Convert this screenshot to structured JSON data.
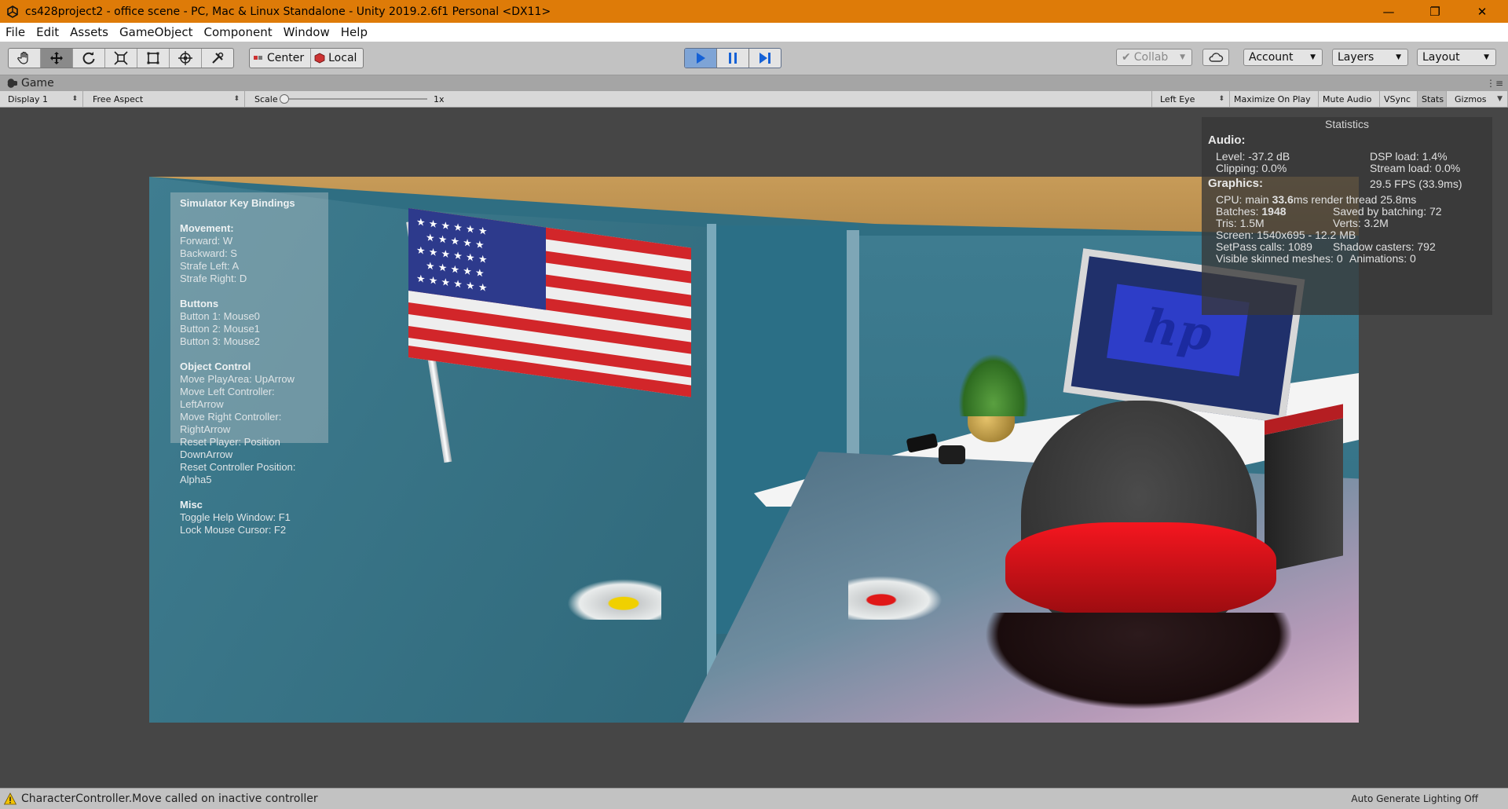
{
  "window": {
    "title": "cs428project2 - office scene - PC, Mac & Linux Standalone - Unity 2019.2.6f1 Personal <DX11>",
    "controls": [
      "—",
      "❐",
      "✕"
    ]
  },
  "menu": [
    "File",
    "Edit",
    "Assets",
    "GameObject",
    "Component",
    "Window",
    "Help"
  ],
  "toolbar": {
    "transform_tools": [
      "hand-tool",
      "move-tool",
      "rotate-tool",
      "scale-tool",
      "rect-tool",
      "transform-tool",
      "custom-tool"
    ],
    "active_tool": "move-tool",
    "pivot_label": "Center",
    "space_label": "Local",
    "play_state": "playing",
    "collab_label": "Collab",
    "account_label": "Account",
    "layers_label": "Layers",
    "layout_label": "Layout"
  },
  "tab": {
    "label": "Game"
  },
  "game_bar": {
    "display": "Display 1",
    "aspect": "Free Aspect",
    "scale_label": "Scale",
    "scale_value": "1x",
    "eye": "Left Eye",
    "maximize": "Maximize On Play",
    "mute": "Mute Audio",
    "vsync": "VSync",
    "stats": "Stats",
    "gizmos": "Gizmos"
  },
  "keybindings": {
    "title": "Simulator Key Bindings",
    "movement_header": "Movement:",
    "movement": [
      "Forward: W",
      "Backward: S",
      "Strafe Left: A",
      "Strafe Right: D"
    ],
    "buttons_header": "Buttons",
    "buttons": [
      "Button 1: Mouse0",
      "Button 2: Mouse1",
      "Button 3: Mouse2"
    ],
    "object_header": "Object Control",
    "object": [
      "Move PlayArea: UpArrow",
      "Move Left Controller: LeftArrow",
      "Move Right Controller: RightArrow",
      "Reset Player: Position DownArrow",
      "Reset Controller Position: Alpha5"
    ],
    "misc_header": "Misc",
    "misc": [
      "Toggle Help Window: F1",
      "Lock Mouse Cursor: F2"
    ]
  },
  "stats": {
    "title": "Statistics",
    "audio_header": "Audio:",
    "level": "Level: -37.2 dB",
    "clipping": "Clipping: 0.0%",
    "dsp": "DSP load: 1.4%",
    "stream": "Stream load: 0.0%",
    "graphics_header": "Graphics:",
    "fps": "29.5 FPS (33.9ms)",
    "cpu_prefix": "CPU: main ",
    "cpu_main": "33.6",
    "cpu_suffix": "ms  render thread 25.8ms",
    "batches_prefix": "Batches: ",
    "batches": "1948",
    "saved": "Saved by batching: 72",
    "tris": "Tris: 1.5M",
    "verts": "Verts: 3.2M",
    "screen": "Screen: 1540x695 - 12.2 MB",
    "setpass": "SetPass calls: 1089",
    "shadow": "Shadow casters: 792",
    "skinned": "Visible skinned meshes: 0",
    "animations": "Animations: 0"
  },
  "scene": {
    "monitor_logo": "hp"
  },
  "status": {
    "message": "CharacterController.Move called on inactive controller",
    "right": "Auto Generate Lighting Off"
  }
}
